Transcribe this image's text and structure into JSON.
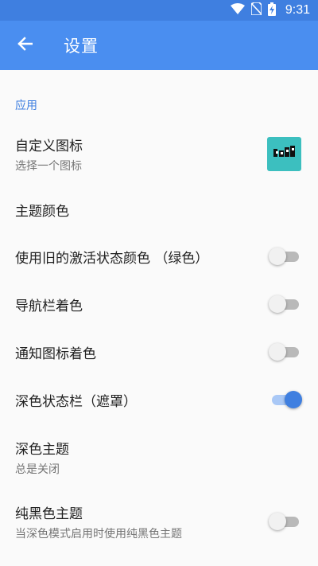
{
  "status_bar": {
    "time": "9:31",
    "icons": [
      "wifi-icon",
      "no-sim-icon",
      "battery-charging-icon"
    ]
  },
  "app_bar": {
    "title": "设置",
    "back_icon": "arrow-back-icon"
  },
  "colors": {
    "primary": "#4a8ef0",
    "accent": "#3f7fe0",
    "icon_bg": "#3cbfbf"
  },
  "section": {
    "label": "应用"
  },
  "settings": {
    "custom_icon": {
      "title": "自定义图标",
      "subtitle": "选择一个图标"
    },
    "theme_color": {
      "title": "主题颜色"
    },
    "legacy_active_color": {
      "title": "使用旧的激活状态颜色 （绿色）",
      "enabled": false
    },
    "nav_bar_tint": {
      "title": "导航栏着色",
      "enabled": false
    },
    "notification_icon_tint": {
      "title": "通知图标着色",
      "enabled": false
    },
    "dark_status_bar": {
      "title": "深色状态栏（遮罩）",
      "enabled": true
    },
    "dark_theme": {
      "title": "深色主题",
      "subtitle": "总是关闭"
    },
    "pure_black_theme": {
      "title": "纯黑色主题",
      "subtitle": "当深色模式启用时使用纯黑色主题",
      "enabled": false
    }
  }
}
